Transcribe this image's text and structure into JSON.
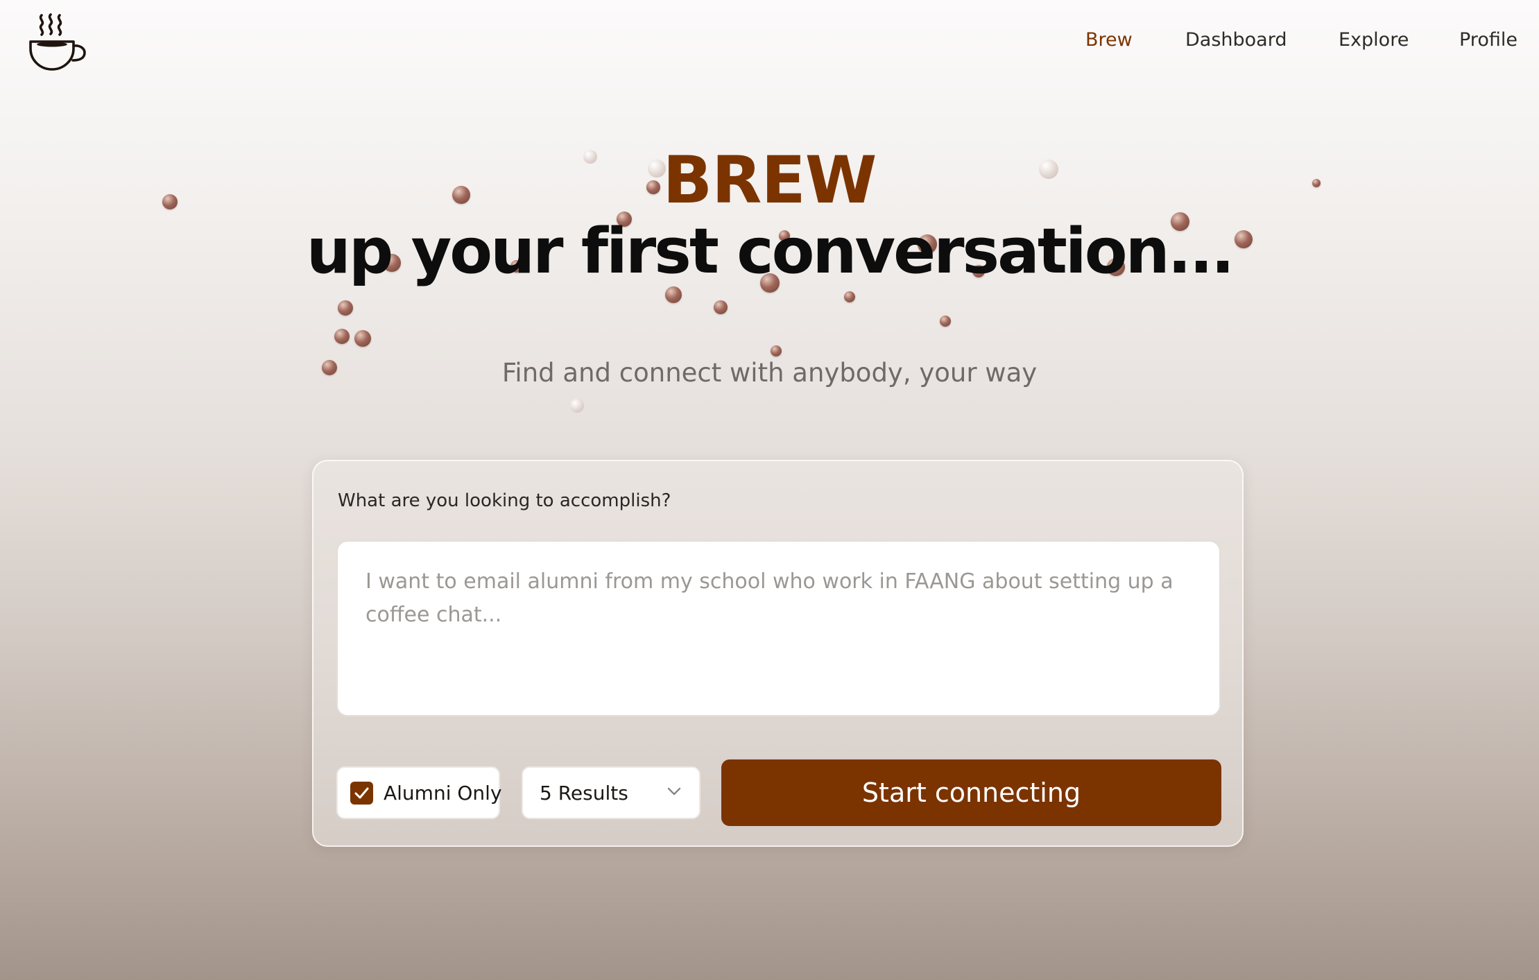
{
  "nav": {
    "items": [
      {
        "label": "Brew",
        "active": true
      },
      {
        "label": "Dashboard",
        "active": false
      },
      {
        "label": "Explore",
        "active": false
      },
      {
        "label": "Profile",
        "active": false
      }
    ]
  },
  "hero": {
    "brand": "BREW",
    "headline": "up your first conversation...",
    "subtitle": "Find and connect with anybody, your way"
  },
  "form": {
    "question": "What are you looking to accomplish?",
    "goal_value": "",
    "goal_placeholder": "I want to email alumni from my school who work in FAANG about setting up a coffee chat...",
    "alumni_only_label": "Alumni Only",
    "alumni_only_checked": true,
    "results_selected": "5 Results",
    "submit_label": "Start connecting"
  },
  "colors": {
    "brand": "#7b3400",
    "text": "#0d0d0d",
    "muted": "#6e6a67"
  },
  "icons": {
    "logo": "coffee-cup-icon",
    "checkbox": "check-icon",
    "select": "chevron-down-icon"
  }
}
